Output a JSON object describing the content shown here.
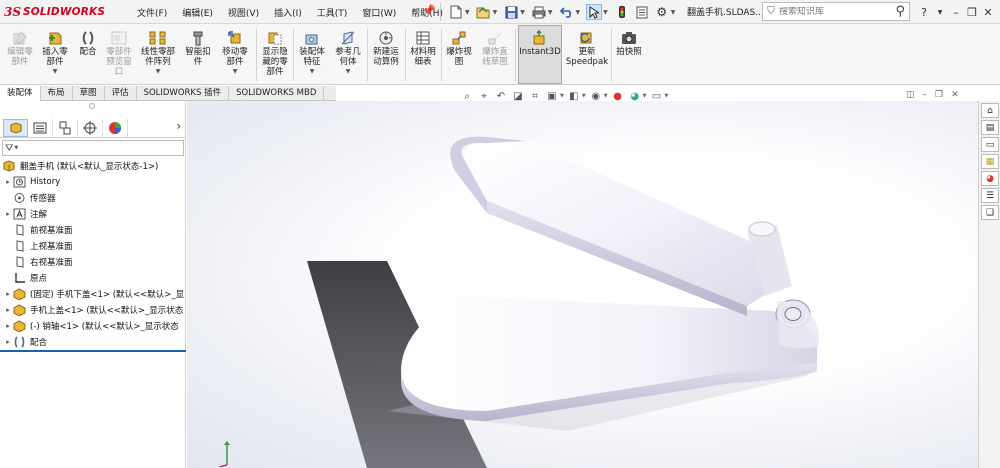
{
  "app": {
    "logo_ds": "3S",
    "brand": "SOLIDWORKS",
    "document": "翻盖手机.SLDAS...",
    "search_placeholder": "搜索知识库"
  },
  "menu": [
    "文件(F)",
    "编辑(E)",
    "视图(V)",
    "插入(I)",
    "工具(T)",
    "窗口(W)",
    "帮助(H)"
  ],
  "quick_icons": [
    "new-document-icon",
    "open-icon",
    "save-icon",
    "print-icon",
    "undo-icon",
    "select-pointer-icon",
    "rebuild-icon",
    "file-properties-icon",
    "options-gear-icon"
  ],
  "window_controls": {
    "help": "?",
    "minimize": "–",
    "restore": "❐",
    "close": "✕"
  },
  "ribbon": [
    {
      "label": "编辑零\n部件",
      "disabled": true,
      "icon": "edit-component-icon"
    },
    {
      "label": "插入零\n部件",
      "disabled": false,
      "icon": "insert-component-icon",
      "dropdown": true
    },
    {
      "label": "配合",
      "disabled": false,
      "icon": "mate-icon"
    },
    {
      "label": "零部件\n预览窗\n口",
      "disabled": true,
      "icon": "component-preview-icon"
    },
    {
      "label": "线性零部\n件阵列",
      "disabled": false,
      "icon": "linear-pattern-icon",
      "dropdown": true
    },
    {
      "label": "智能扣\n件",
      "disabled": false,
      "icon": "smart-fasteners-icon"
    },
    {
      "label": "移动零\n部件",
      "disabled": false,
      "icon": "move-component-icon",
      "dropdown": true
    },
    {
      "label": "显示隐\n藏的零\n部件",
      "disabled": false,
      "icon": "show-hidden-icon"
    },
    {
      "label": "装配体\n特征",
      "disabled": false,
      "icon": "assembly-features-icon",
      "dropdown": true
    },
    {
      "label": "参考几\n何体",
      "disabled": false,
      "icon": "reference-geometry-icon",
      "dropdown": true
    },
    {
      "label": "新建运\n动算例",
      "disabled": false,
      "icon": "motion-study-icon"
    },
    {
      "label": "材料明\n细表",
      "disabled": false,
      "icon": "bom-icon"
    },
    {
      "label": "爆炸视\n图",
      "disabled": false,
      "icon": "exploded-view-icon"
    },
    {
      "label": "爆炸直\n线草图",
      "disabled": true,
      "icon": "explode-line-sketch-icon"
    },
    {
      "label": "Instant3D",
      "disabled": false,
      "icon": "instant3d-icon",
      "active": true
    },
    {
      "label": "更新\nSpeedpak",
      "disabled": false,
      "icon": "speedpak-icon"
    },
    {
      "label": "拍快照",
      "disabled": false,
      "icon": "snapshot-icon"
    }
  ],
  "tabs": [
    {
      "label": "装配体",
      "active": true
    },
    {
      "label": "布局",
      "active": false
    },
    {
      "label": "草图",
      "active": false
    },
    {
      "label": "评估",
      "active": false
    },
    {
      "label": "SOLIDWORKS 插件",
      "active": false
    },
    {
      "label": "SOLIDWORKS MBD",
      "active": false
    }
  ],
  "view_toolbar": [
    "zoom-to-fit-icon",
    "zoom-to-area-icon",
    "previous-view-icon",
    "section-view-icon",
    "dynamic-annotation-icon",
    "view-orientation-icon",
    "display-style-icon",
    "hide-show-items-icon",
    "edit-appearance-icon",
    "apply-scene-icon",
    "view-settings-icon"
  ],
  "tree": {
    "root": "翻盖手机  (默认<默认_显示状态-1>)",
    "items": [
      {
        "label": "History",
        "expander": "▸",
        "icon": "history-icon"
      },
      {
        "label": "传感器",
        "expander": "",
        "icon": "sensor-icon"
      },
      {
        "label": "注解",
        "expander": "▸",
        "icon": "annotation-icon"
      },
      {
        "label": "前视基准面",
        "expander": "",
        "icon": "plane-icon"
      },
      {
        "label": "上视基准面",
        "expander": "",
        "icon": "plane-icon"
      },
      {
        "label": "右视基准面",
        "expander": "",
        "icon": "plane-icon"
      },
      {
        "label": "原点",
        "expander": "",
        "icon": "origin-icon"
      },
      {
        "label": "(固定) 手机下盖<1> (默认<<默认>_显",
        "expander": "▸",
        "icon": "part-icon"
      },
      {
        "label": "手机上盖<1> (默认<<默认>_显示状态",
        "expander": "▸",
        "icon": "part-icon"
      },
      {
        "label": "(-) 销轴<1> (默认<<默认>_显示状态",
        "expander": "▸",
        "icon": "part-icon"
      },
      {
        "label": "配合",
        "expander": "▸",
        "icon": "mates-folder-icon"
      }
    ]
  },
  "task_pane": [
    "home-icon",
    "3d-content-icon",
    "design-library-icon",
    "file-explorer-icon",
    "appearances-icon",
    "custom-properties-icon",
    "forum-icon"
  ],
  "colors": {
    "brand_red": "#d6001c",
    "accent_blue": "#1b5fb4",
    "part_yellow": "#e9b636"
  }
}
